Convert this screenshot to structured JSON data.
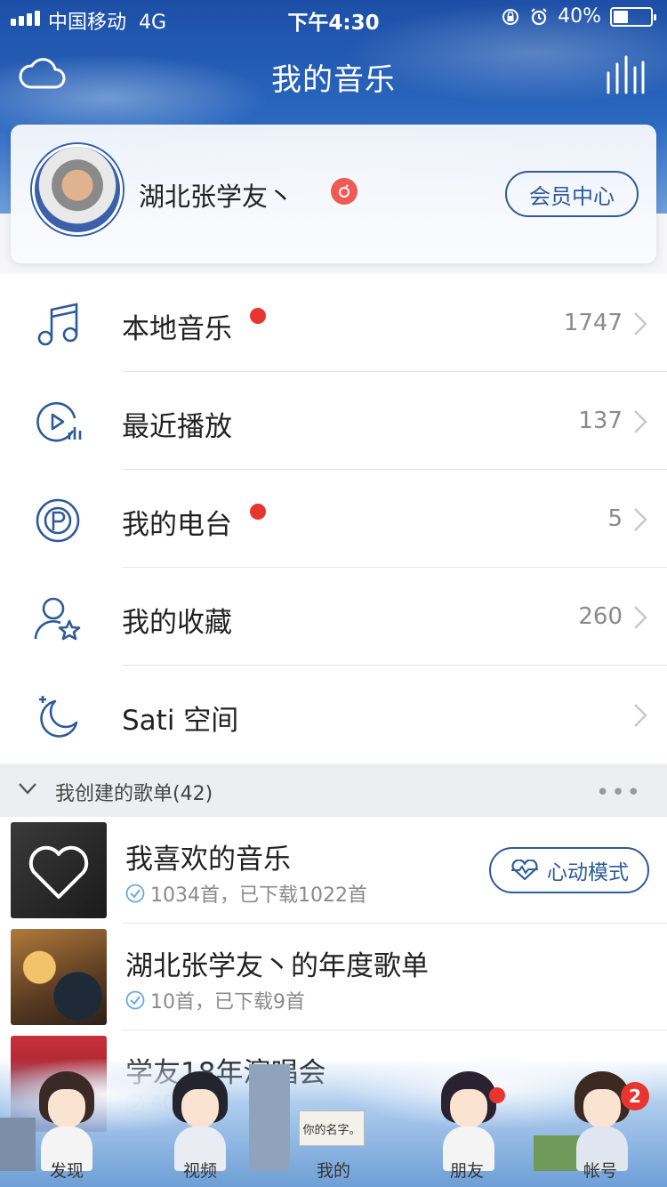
{
  "status_bar": {
    "carrier": "中国移动",
    "network": "4G",
    "time": "下午4:30",
    "battery": "40%",
    "battery_level": 0.4
  },
  "header": {
    "title": "我的音乐"
  },
  "profile": {
    "username": "湖北张学友丶",
    "member_button": "会员中心"
  },
  "menu": {
    "items": [
      {
        "label": "本地音乐",
        "count": "1747",
        "has_dot": true
      },
      {
        "label": "最近播放",
        "count": "137",
        "has_dot": false
      },
      {
        "label": "我的电台",
        "count": "5",
        "has_dot": true
      },
      {
        "label": "我的收藏",
        "count": "260",
        "has_dot": false
      },
      {
        "label": "Sati 空间",
        "count": "",
        "has_dot": false
      }
    ]
  },
  "section": {
    "title": "我创建的歌单(42)",
    "more": "•••"
  },
  "playlists": [
    {
      "name": "我喜欢的音乐",
      "subtitle": "1034首，已下载1022首",
      "button": "心动模式"
    },
    {
      "name": "湖北张学友丶的年度歌单",
      "subtitle": "10首，已下载9首"
    },
    {
      "name": "学友18年演唱会",
      "subtitle": "40"
    }
  ],
  "tabbar": {
    "tabs": [
      "发现",
      "视频",
      "我的",
      "朋友",
      "帐号"
    ],
    "account_badge": "2",
    "sign_text": "你的名字。"
  },
  "colors": {
    "accent": "#2e5a99",
    "badge_red": "#e8352f",
    "vip_red": "#ef5a53",
    "sky_blue": "#2a67bf"
  }
}
